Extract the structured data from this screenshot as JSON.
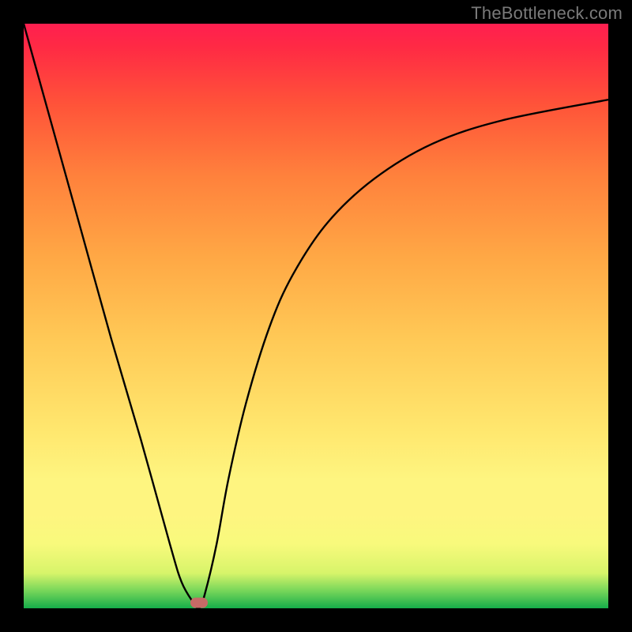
{
  "watermark": "TheBottleneck.com",
  "chart_data": {
    "type": "line",
    "title": "",
    "xlabel": "",
    "ylabel": "",
    "xlim": [
      0,
      100
    ],
    "ylim": [
      0,
      100
    ],
    "grid": false,
    "series": [
      {
        "name": "curve",
        "x": [
          0,
          5,
          10,
          15,
          20,
          25,
          27,
          29,
          30,
          31,
          33,
          35,
          38,
          42,
          46,
          52,
          60,
          70,
          82,
          100
        ],
        "values": [
          100,
          82,
          64,
          46,
          29,
          11,
          4.5,
          1,
          0,
          2.5,
          11,
          22,
          35,
          48,
          57,
          66,
          73.5,
          79.5,
          83.5,
          87
        ]
      }
    ],
    "marker": {
      "x": 30,
      "y": 0.9
    },
    "background_gradient": {
      "top": "#ff1f50",
      "middle_upper": "#ffa845",
      "middle_lower": "#fef580",
      "bottom": "#16ad4a"
    }
  }
}
